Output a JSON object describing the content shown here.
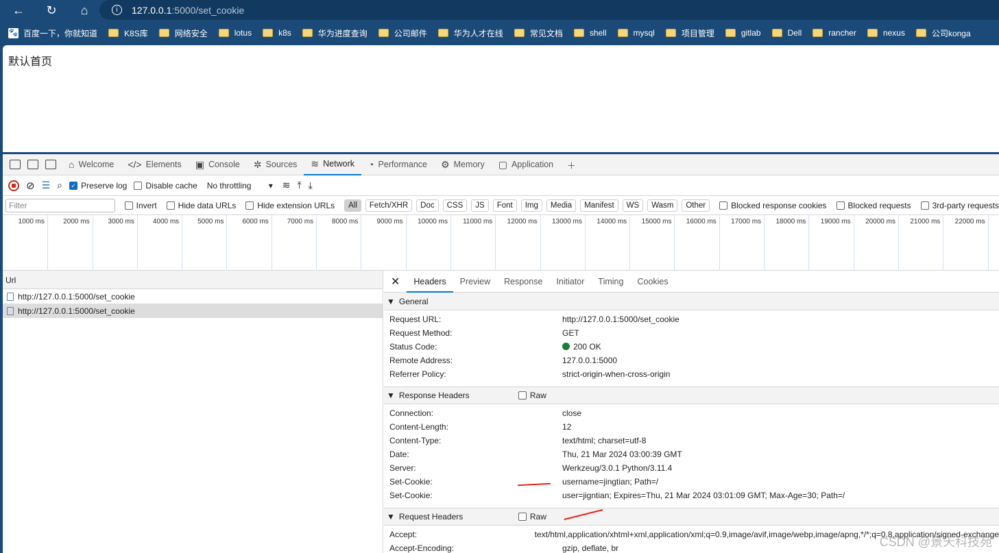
{
  "browser": {
    "url_host": "127.0.0.1",
    "url_path": ":5000/set_cookie",
    "bookmarks": [
      "百度一下，你就知道",
      "K8S库",
      "网络安全",
      "lotus",
      "k8s",
      "华为进度查询",
      "公司邮件",
      "华为人才在线",
      "常见文档",
      "shell",
      "mysql",
      "项目管理",
      "gitlab",
      "Dell",
      "rancher",
      "nexus",
      "公司konga"
    ]
  },
  "page": {
    "text": "默认首页"
  },
  "devtools": {
    "tabs": [
      {
        "label": "Welcome",
        "icon": "⌂"
      },
      {
        "label": "Elements",
        "icon": "</>"
      },
      {
        "label": "Console",
        "icon": "▣"
      },
      {
        "label": "Sources",
        "icon": "✲"
      },
      {
        "label": "Network",
        "icon": "≋"
      },
      {
        "label": "Performance",
        "icon": "◔"
      },
      {
        "label": "Memory",
        "icon": "⚙"
      },
      {
        "label": "Application",
        "icon": "▢"
      }
    ],
    "toolbar": {
      "preserve_log": "Preserve log",
      "disable_cache": "Disable cache",
      "throttling": "No throttling"
    },
    "filter": {
      "placeholder": "Filter",
      "invert": "Invert",
      "hide_data": "Hide data URLs",
      "hide_ext": "Hide extension URLs",
      "types": [
        "All",
        "Fetch/XHR",
        "Doc",
        "CSS",
        "JS",
        "Font",
        "Img",
        "Media",
        "Manifest",
        "WS",
        "Wasm",
        "Other"
      ],
      "blocked_cookies": "Blocked response cookies",
      "blocked_requests": "Blocked requests",
      "third_party": "3rd-party requests"
    },
    "timeline": [
      "1000 ms",
      "2000 ms",
      "3000 ms",
      "4000 ms",
      "5000 ms",
      "6000 ms",
      "7000 ms",
      "8000 ms",
      "9000 ms",
      "10000 ms",
      "11000 ms",
      "12000 ms",
      "13000 ms",
      "14000 ms",
      "15000 ms",
      "16000 ms",
      "17000 ms",
      "18000 ms",
      "19000 ms",
      "20000 ms",
      "21000 ms",
      "22000 ms"
    ],
    "list": {
      "header": "Url",
      "rows": [
        "http://127.0.0.1:5000/set_cookie",
        "http://127.0.0.1:5000/set_cookie"
      ]
    },
    "detail_tabs": [
      "Headers",
      "Preview",
      "Response",
      "Initiator",
      "Timing",
      "Cookies"
    ],
    "general": {
      "title": "General",
      "rows": [
        [
          "Request URL:",
          "http://127.0.0.1:5000/set_cookie"
        ],
        [
          "Request Method:",
          "GET"
        ],
        [
          "Status Code:",
          "200 OK"
        ],
        [
          "Remote Address:",
          "127.0.0.1:5000"
        ],
        [
          "Referrer Policy:",
          "strict-origin-when-cross-origin"
        ]
      ]
    },
    "response": {
      "title": "Response Headers",
      "raw": "Raw",
      "rows": [
        [
          "Connection:",
          "close"
        ],
        [
          "Content-Length:",
          "12"
        ],
        [
          "Content-Type:",
          "text/html; charset=utf-8"
        ],
        [
          "Date:",
          "Thu, 21 Mar 2024 03:00:39 GMT"
        ],
        [
          "Server:",
          "Werkzeug/3.0.1 Python/3.11.4"
        ],
        [
          "Set-Cookie:",
          "username=jingtian; Path=/"
        ],
        [
          "Set-Cookie:",
          "user=jigntian; Expires=Thu, 21 Mar 2024 03:01:09 GMT; Max-Age=30; Path=/"
        ]
      ]
    },
    "request": {
      "title": "Request Headers",
      "raw": "Raw",
      "rows": [
        [
          "Accept:",
          "text/html,application/xhtml+xml,application/xml;q=0.9,image/avif,image/webp,image/apng,*/*;q=0.8,application/signed-exchange"
        ],
        [
          "Accept-Encoding:",
          "gzip, deflate, br"
        ]
      ]
    }
  },
  "watermark": "CSDN @景天科技苑",
  "colors": {
    "status_ok": "#1e7d34",
    "accent": "#0078d4",
    "record": "#c42b1c",
    "arrow": "#e3261b"
  }
}
